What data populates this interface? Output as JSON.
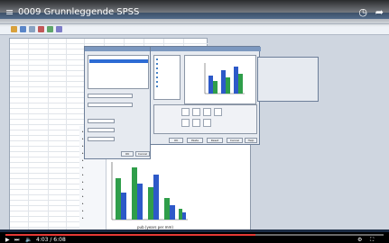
{
  "video": {
    "title": "0009 Grunnleggende SPSS",
    "menu_icon": "hamburger-menu-icon",
    "clock_icon": "clock-icon",
    "share_icon": "share-icon",
    "progress_fraction": 0.66,
    "time_display": "4:03 / 6:08"
  },
  "spss": {
    "viewer_axis_label": "pub (years per mm)"
  },
  "dialog": {
    "ok_label": "OK",
    "cancel_label": "Cancel",
    "help_label": "Help",
    "reset_label": "Reset",
    "paste_label": "Paste"
  },
  "colors": {
    "bar_green": "#2f9e4a",
    "bar_blue": "#2d59c8",
    "selection": "#2d6bd4",
    "progress": "#e53935"
  }
}
